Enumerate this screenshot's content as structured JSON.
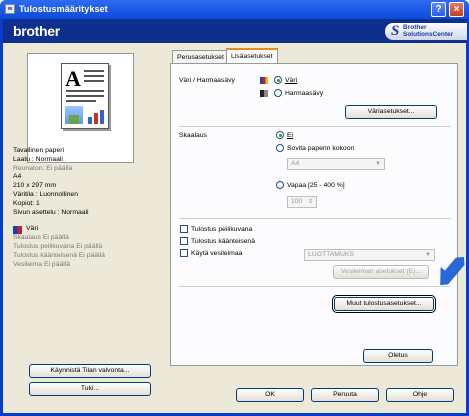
{
  "window": {
    "title": "Tulostusmääritykset",
    "help_glyph": "?",
    "close_glyph": "×"
  },
  "banner": {
    "brand": "brother",
    "solutions_line1": "Brother",
    "solutions_line2": "SolutionsCenter"
  },
  "summary": {
    "lines": [
      "Tavallinen paperi",
      "Laatu : Normaali",
      "Reunaton: Ei päällä",
      "A4",
      "210 x 297 mm",
      "Väritila : Luonnollinen",
      "Kopiot: 1",
      "Sivun asettelu : Normaali"
    ],
    "dim_index": 2,
    "color_label": "Väri",
    "extra_lines": [
      "Skaalaus Ei päällä",
      "Tulostus peilikuvana Ei päällä",
      "Tulostus käänteisenä Ei päällä",
      "Vesileima Ei päällä"
    ]
  },
  "left_buttons": {
    "status_monitor": "Käynnistä Tilan valvonta...",
    "support": "Tuki..."
  },
  "tabs": [
    {
      "label": "Perusasetukset",
      "active": false
    },
    {
      "label": "Lisäasetukset",
      "active": true
    }
  ],
  "color": {
    "section_label": "Väri / Harmaasävy",
    "option_color": "Väri",
    "option_gray": "Harmaasävy",
    "settings_button": "Väriasetukset..."
  },
  "scaling": {
    "section_label": "Skaalaus",
    "option_off": "Ei",
    "option_fit": "Sovita paperin kokoon",
    "fit_select": "A4",
    "option_free": "Vapaa [25 - 400 %]",
    "free_value": "100"
  },
  "options": {
    "mirror": "Tulostus peilikuvana",
    "reverse": "Tulostus käänteisenä",
    "watermark": "Käytä vesileimaa",
    "watermark_select": "LUOTTAMUKS",
    "watermark_settings": "Vesileiman asetukset (E)...",
    "other_settings": "Muut tulostusasetukset..."
  },
  "bottom": {
    "default": "Oletus",
    "ok": "OK",
    "cancel": "Peruuta",
    "help": "Ohje"
  },
  "colors": {
    "title_bar": "#0b49d8",
    "banner": "#0e2f8c",
    "dialog_bg": "#ece9d8",
    "tab_accent": "#e68b2c",
    "arrow": "#2a68d8"
  }
}
